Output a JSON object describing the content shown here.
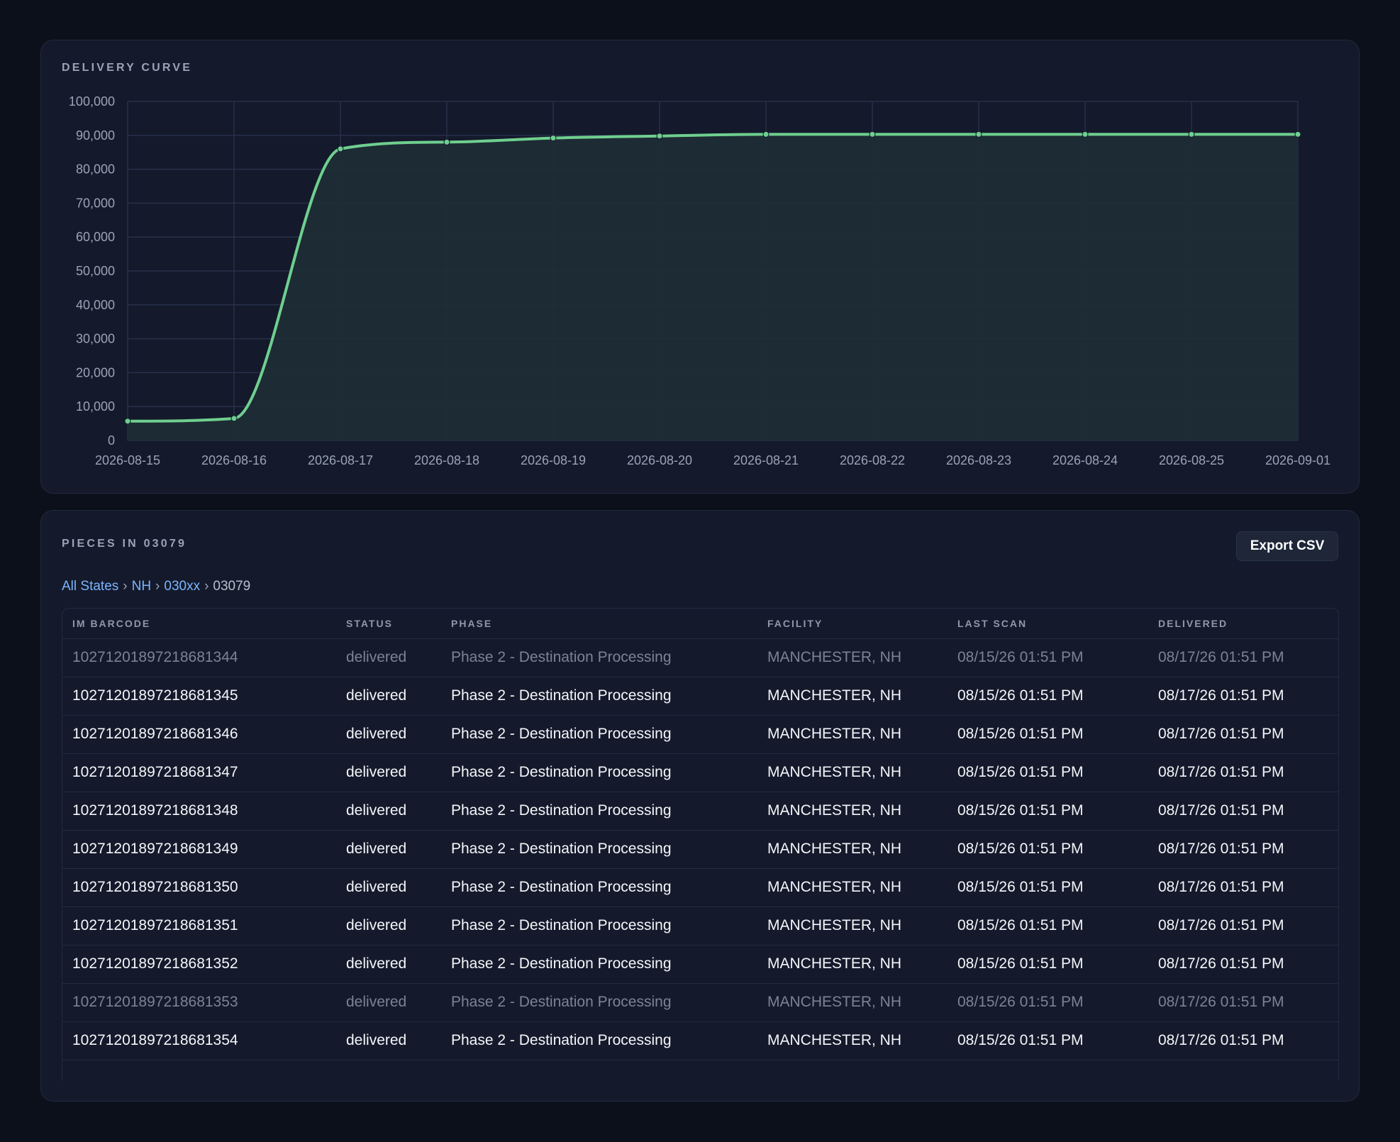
{
  "chart_card": {
    "title": "DELIVERY CURVE"
  },
  "chart_data": {
    "type": "area",
    "title": "DELIVERY CURVE",
    "categories": [
      "2026-08-15",
      "2026-08-16",
      "2026-08-17",
      "2026-08-18",
      "2026-08-19",
      "2026-08-20",
      "2026-08-21",
      "2026-08-22",
      "2026-08-23",
      "2026-08-24",
      "2026-08-25",
      "2026-09-01"
    ],
    "values": [
      5700,
      6500,
      86000,
      88000,
      89200,
      89800,
      90300,
      90300,
      90300,
      90300,
      90300,
      90300
    ],
    "yticks": [
      "0",
      "10,000",
      "20,000",
      "30,000",
      "40,000",
      "50,000",
      "60,000",
      "70,000",
      "80,000",
      "90,000",
      "100,000"
    ],
    "ylim": [
      0,
      100000
    ],
    "xlabel": "",
    "ylabel": "",
    "grid": true,
    "colors": {
      "line": "#6fcf8f",
      "fill": "#1e2d35",
      "grid": "#26304a",
      "tick": "#9aa3b5"
    }
  },
  "table_card": {
    "title": "PIECES IN 03079",
    "export_label": "Export CSV",
    "breadcrumb": [
      {
        "label": "All States",
        "link": true
      },
      {
        "label": "NH",
        "link": true
      },
      {
        "label": "030xx",
        "link": true
      },
      {
        "label": "03079",
        "link": false
      }
    ],
    "breadcrumb_separator": "›",
    "columns": [
      "IM BARCODE",
      "STATUS",
      "PHASE",
      "FACILITY",
      "LAST SCAN",
      "DELIVERED"
    ],
    "rows": [
      {
        "barcode": "10271201897218681344",
        "status": "delivered",
        "phase": "Phase 2 - Destination Processing",
        "facility": "MANCHESTER, NH",
        "last_scan": "08/15/26 01:51 PM",
        "delivered": "08/17/26 01:51 PM",
        "dim": true
      },
      {
        "barcode": "10271201897218681345",
        "status": "delivered",
        "phase": "Phase 2 - Destination Processing",
        "facility": "MANCHESTER, NH",
        "last_scan": "08/15/26 01:51 PM",
        "delivered": "08/17/26 01:51 PM",
        "dim": false
      },
      {
        "barcode": "10271201897218681346",
        "status": "delivered",
        "phase": "Phase 2 - Destination Processing",
        "facility": "MANCHESTER, NH",
        "last_scan": "08/15/26 01:51 PM",
        "delivered": "08/17/26 01:51 PM",
        "dim": false
      },
      {
        "barcode": "10271201897218681347",
        "status": "delivered",
        "phase": "Phase 2 - Destination Processing",
        "facility": "MANCHESTER, NH",
        "last_scan": "08/15/26 01:51 PM",
        "delivered": "08/17/26 01:51 PM",
        "dim": false
      },
      {
        "barcode": "10271201897218681348",
        "status": "delivered",
        "phase": "Phase 2 - Destination Processing",
        "facility": "MANCHESTER, NH",
        "last_scan": "08/15/26 01:51 PM",
        "delivered": "08/17/26 01:51 PM",
        "dim": false
      },
      {
        "barcode": "10271201897218681349",
        "status": "delivered",
        "phase": "Phase 2 - Destination Processing",
        "facility": "MANCHESTER, NH",
        "last_scan": "08/15/26 01:51 PM",
        "delivered": "08/17/26 01:51 PM",
        "dim": false
      },
      {
        "barcode": "10271201897218681350",
        "status": "delivered",
        "phase": "Phase 2 - Destination Processing",
        "facility": "MANCHESTER, NH",
        "last_scan": "08/15/26 01:51 PM",
        "delivered": "08/17/26 01:51 PM",
        "dim": false
      },
      {
        "barcode": "10271201897218681351",
        "status": "delivered",
        "phase": "Phase 2 - Destination Processing",
        "facility": "MANCHESTER, NH",
        "last_scan": "08/15/26 01:51 PM",
        "delivered": "08/17/26 01:51 PM",
        "dim": false
      },
      {
        "barcode": "10271201897218681352",
        "status": "delivered",
        "phase": "Phase 2 - Destination Processing",
        "facility": "MANCHESTER, NH",
        "last_scan": "08/15/26 01:51 PM",
        "delivered": "08/17/26 01:51 PM",
        "dim": false
      },
      {
        "barcode": "10271201897218681353",
        "status": "delivered",
        "phase": "Phase 2 - Destination Processing",
        "facility": "MANCHESTER, NH",
        "last_scan": "08/15/26 01:51 PM",
        "delivered": "08/17/26 01:51 PM",
        "dim": true
      },
      {
        "barcode": "10271201897218681354",
        "status": "delivered",
        "phase": "Phase 2 - Destination Processing",
        "facility": "MANCHESTER, NH",
        "last_scan": "08/15/26 01:51 PM",
        "delivered": "08/17/26 01:51 PM",
        "dim": false
      }
    ]
  }
}
